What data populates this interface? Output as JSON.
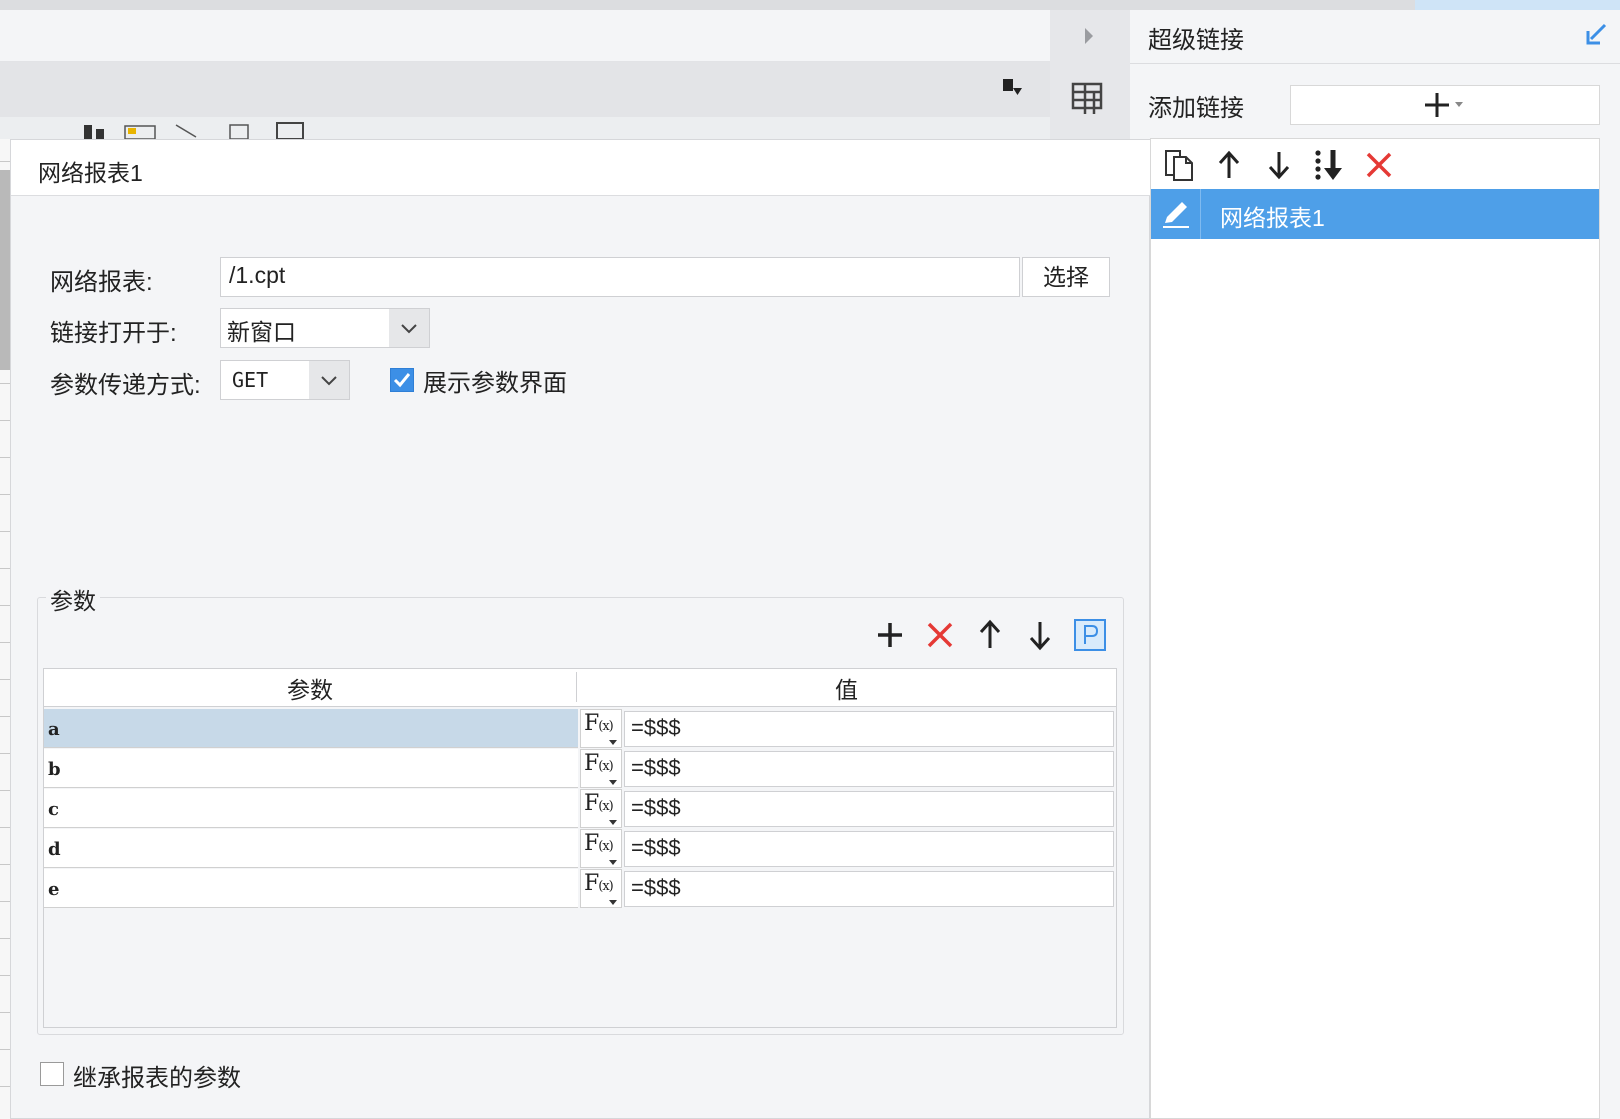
{
  "panel": {
    "title": "超级链接",
    "add_link_label": "添加链接",
    "items": [
      {
        "label": "网络报表1",
        "selected": true
      }
    ]
  },
  "dialog": {
    "title": "网络报表1",
    "report_label": "网络报表:",
    "report_path": "/1.cpt",
    "select_button": "选择",
    "open_in_label": "链接打开于:",
    "open_in_value": "新窗口",
    "method_label": "参数传递方式:",
    "method_value": "GET",
    "show_params_label": "展示参数界面",
    "show_params_checked": true,
    "params_group_title": "参数",
    "table": {
      "headers": [
        "参数",
        "值"
      ],
      "rows": [
        {
          "name": "a",
          "value": "=$$$",
          "selected": true
        },
        {
          "name": "b",
          "value": "=$$$"
        },
        {
          "name": "c",
          "value": "=$$$"
        },
        {
          "name": "d",
          "value": "=$$$"
        },
        {
          "name": "e",
          "value": "=$$$"
        }
      ]
    },
    "inherit_label": "继承报表的参数",
    "inherit_checked": false
  },
  "colors": {
    "accent": "#4e9fe8",
    "delete_red": "#e53935",
    "selected_row": "#c7d9e8"
  }
}
